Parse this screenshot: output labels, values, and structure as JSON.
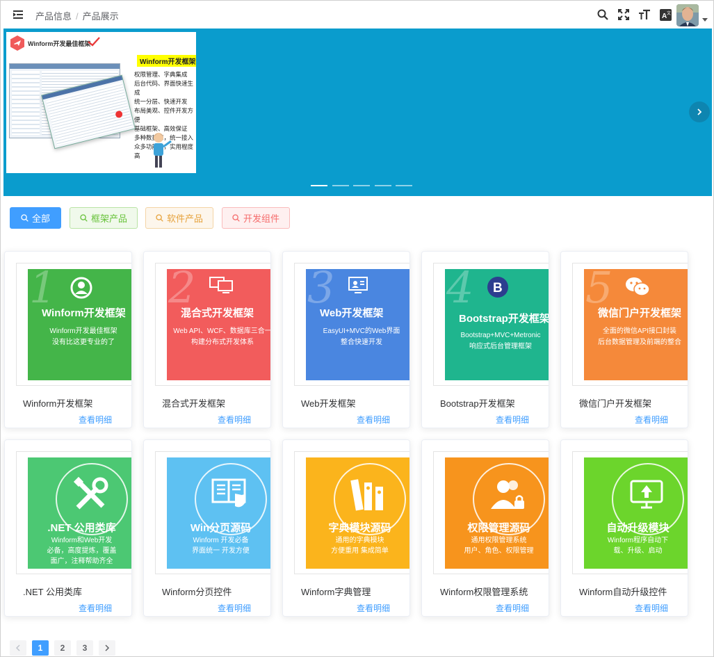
{
  "breadcrumb": {
    "items": [
      "产品信息",
      "产品展示"
    ]
  },
  "header_icons": [
    "search-icon",
    "fullscreen-icon",
    "font-size-icon",
    "translate-icon"
  ],
  "carousel": {
    "slide": {
      "logo_text": "Winform开发最佳框架",
      "heading": "Winform开发框架",
      "lines": [
        "权限管理、字典集成",
        "后台代码、界面快速生成",
        "统一分层、快速开发",
        "布局美观、控件开发方便",
        "基础框架、高效保证",
        "多种数据库，统一接入",
        "众多功能点，实用程度高"
      ]
    },
    "indicator_count": 5,
    "active_index": 0
  },
  "filters": [
    {
      "label": "全部",
      "color": "#409eff",
      "active": true
    },
    {
      "label": "框架产品",
      "color": "#67c23a",
      "active": false
    },
    {
      "label": "软件产品",
      "color": "#e6a23c",
      "active": false
    },
    {
      "label": "开发组件",
      "color": "#f56c6c",
      "active": false
    }
  ],
  "cards": [
    {
      "title": "Winform开发框架",
      "link": "查看明细",
      "banner": {
        "num": "1",
        "color": "#44b549",
        "icon": "user-circle-icon",
        "heading": "Winform开发框架",
        "sub": [
          "Winform开发最佳框架",
          "没有比这更专业的了"
        ]
      }
    },
    {
      "title": "混合式开发框架",
      "link": "查看明细",
      "banner": {
        "num": "2",
        "color": "#f25c5c",
        "icon": "monitors-icon",
        "heading": "混合式开发框架",
        "sub": [
          "Web API、WCF、数据库三合一",
          "构建分布式开发体系"
        ]
      }
    },
    {
      "title": "Web开发框架",
      "link": "查看明细",
      "banner": {
        "num": "3",
        "color": "#4a86e0",
        "icon": "web-screen-icon",
        "heading": "Web开发框架",
        "sub": [
          "EasyUI+MVC的Web界面",
          "整合快速开发"
        ]
      }
    },
    {
      "title": "Bootstrap开发框架",
      "link": "查看明细",
      "banner": {
        "num": "4",
        "color": "#1fb58e",
        "icon": "bootstrap-icon",
        "heading": "Bootstrap开发框架",
        "sub": [
          "Bootstrap+MVC+Metronic",
          "响应式后台管理框架"
        ]
      }
    },
    {
      "title": "微信门户开发框架",
      "link": "查看明细",
      "banner": {
        "num": "5",
        "color": "#f5893a",
        "icon": "wechat-icon",
        "heading": "微信门户开发框架",
        "sub": [
          "全面的微信API接口封装",
          "后台数据管理及前端的整合"
        ]
      }
    },
    {
      "title": ".NET 公用类库",
      "link": "查看明细",
      "banner": {
        "num": "",
        "color": "#4cc873",
        "icon": "tools-icon",
        "heading": ".NET 公用类库",
        "sub": [
          "Winform和Web开发",
          "必备，高度提炼，覆盖",
          "面广，注释帮助齐全"
        ]
      }
    },
    {
      "title": "Winform分页控件",
      "link": "查看明细",
      "banner": {
        "num": "",
        "color": "#5ec1f2",
        "icon": "book-hand-icon",
        "heading": "Win分页源码",
        "sub": [
          "Winform 开发必备",
          "界面统一 开发方便"
        ]
      }
    },
    {
      "title": "Winform字典管理",
      "link": "查看明细",
      "banner": {
        "num": "",
        "color": "#fbb41c",
        "icon": "binders-icon",
        "heading": "字典模块源码",
        "sub": [
          "通用的字典模块",
          "方便重用 集成简单"
        ]
      }
    },
    {
      "title": "Winform权限管理系统",
      "link": "查看明细",
      "banner": {
        "num": "",
        "color": "#f7941d",
        "icon": "users-lock-icon",
        "heading": "权限管理源码",
        "sub": [
          "通用权限管理系统",
          "用户、角色、权限管理"
        ]
      }
    },
    {
      "title": "Winform自动升级控件",
      "link": "查看明细",
      "banner": {
        "num": "",
        "color": "#6cd52c",
        "icon": "upgrade-monitor-icon",
        "heading": "自动升级模块",
        "sub": [
          "Winform程序自动下",
          "载、升级、启动"
        ]
      }
    }
  ],
  "pagination": {
    "pages": [
      "1",
      "2",
      "3"
    ],
    "current": "1"
  }
}
